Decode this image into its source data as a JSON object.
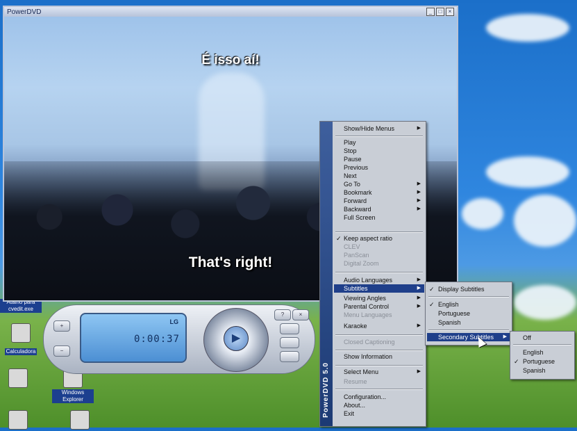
{
  "window": {
    "title": "PowerDVD",
    "controls": [
      "_",
      "□",
      "×"
    ]
  },
  "video": {
    "subtitle_top": "É isso aí!",
    "subtitle_bottom": "That's right!"
  },
  "desktop_icons": [
    {
      "label": "Atalho para cvedit.exe",
      "icon": "shortcut-icon"
    },
    {
      "label": "Calculadora",
      "icon": "calculator-icon"
    },
    {
      "label": "Windows Explorer",
      "icon": "explorer-icon"
    }
  ],
  "panel": {
    "brand": "LG",
    "time": "0:00:37",
    "play_icon": "▶",
    "side_buttons": [
      "+",
      "−",
      "?",
      "×"
    ]
  },
  "menu_main": {
    "band_label": "PowerDVD 5.0",
    "items": [
      {
        "label": "Show/Hide Menus",
        "submenu": true
      },
      {
        "label": "Play"
      },
      {
        "label": "Stop"
      },
      {
        "label": "Pause"
      },
      {
        "label": "Previous"
      },
      {
        "label": "Next"
      },
      {
        "label": "Go To",
        "submenu": true
      },
      {
        "label": "Bookmark",
        "submenu": true
      },
      {
        "label": "Forward",
        "submenu": true
      },
      {
        "label": "Backward",
        "submenu": true
      },
      {
        "label": "Full Screen"
      },
      {
        "label": "Keep aspect ratio",
        "checked": true
      },
      {
        "label": "CLEV",
        "disabled": true
      },
      {
        "label": "PanScan",
        "disabled": true
      },
      {
        "label": "Digital Zoom",
        "disabled": true
      },
      {
        "label": "Audio Languages",
        "submenu": true
      },
      {
        "label": "Subtitles",
        "submenu": true,
        "selected": true
      },
      {
        "label": "Viewing Angles",
        "submenu": true
      },
      {
        "label": "Parental Control",
        "submenu": true
      },
      {
        "label": "Menu Languages",
        "disabled": true
      },
      {
        "label": "Karaoke",
        "submenu": true
      },
      {
        "label": "Closed Captioning",
        "disabled": true
      },
      {
        "label": "Show Information"
      },
      {
        "label": "Select Menu",
        "submenu": true
      },
      {
        "label": "Resume",
        "disabled": true
      },
      {
        "label": "Configuration..."
      },
      {
        "label": "About..."
      },
      {
        "label": "Exit"
      }
    ]
  },
  "menu_subtitles": {
    "items": [
      {
        "label": "Display Subtitles",
        "checked": true
      },
      {
        "label": "English",
        "checked": true
      },
      {
        "label": "Portuguese"
      },
      {
        "label": "Spanish"
      },
      {
        "label": "Secondary Subtitles",
        "submenu": true,
        "selected": true
      }
    ]
  },
  "menu_secondary": {
    "items": [
      {
        "label": "Off"
      },
      {
        "label": "English"
      },
      {
        "label": "Portuguese",
        "checked": true
      },
      {
        "label": "Spanish"
      }
    ]
  },
  "colors": {
    "menu_bg": "#c9ced6",
    "menu_highlight": "#1f3f8a",
    "band": "#2a4a88",
    "lcd": "#6fb0ea"
  }
}
